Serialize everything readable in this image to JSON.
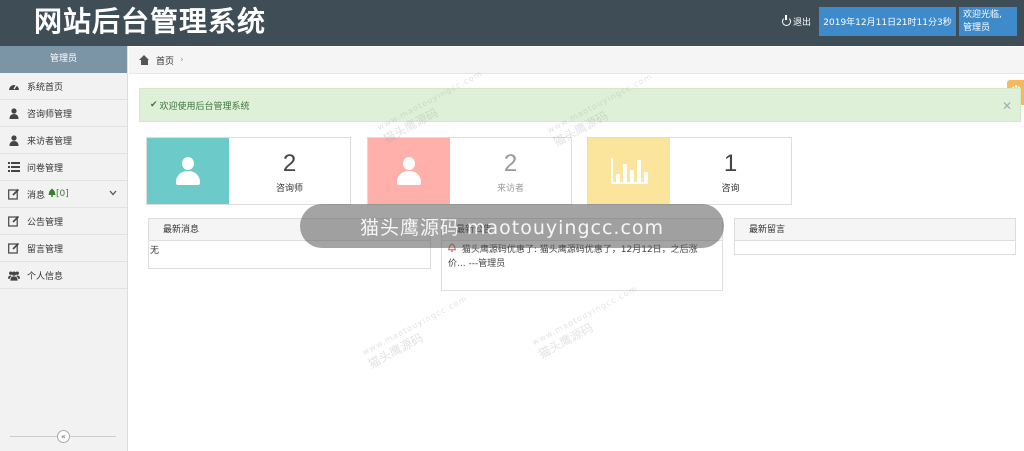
{
  "header": {
    "title": "网站后台管理系统",
    "logout_label": "退出",
    "datetime": "2019年12月11日21时11分3秒",
    "welcome_line1": "欢迎光临,",
    "welcome_line2": "管理员"
  },
  "sidebar": {
    "heading": "管理员",
    "items": [
      {
        "label": "系统首页",
        "icon": "dashboard-icon"
      },
      {
        "label": "咨询师管理",
        "icon": "user-icon"
      },
      {
        "label": "来访者管理",
        "icon": "user-icon"
      },
      {
        "label": "问卷管理",
        "icon": "list-icon"
      },
      {
        "label": "消息",
        "badge": "[0]",
        "icon": "edit-icon"
      },
      {
        "label": "公告管理",
        "icon": "edit-icon"
      },
      {
        "label": "留言管理",
        "icon": "edit-icon"
      },
      {
        "label": "个人信息",
        "icon": "users-icon"
      }
    ]
  },
  "breadcrumb": {
    "home_label": "首页"
  },
  "alert": {
    "message": "欢迎使用后台管理系统"
  },
  "stats": [
    {
      "value": "2",
      "label": "咨询师",
      "color": "#6ccac9"
    },
    {
      "value": "2",
      "label": "来访者",
      "color": "#ff9e9e"
    },
    {
      "value": "1",
      "label": "咨询",
      "color": "#fce38a"
    }
  ],
  "panels": {
    "messages": {
      "title": "最新消息",
      "empty_text": "无"
    },
    "notices": {
      "title": "最新公告",
      "item_line1": "猫头鹰源码优惠了: 猫头鹰源码优惠了，12月12日，之后涨",
      "item_line2": "价... ---管理员"
    },
    "comments": {
      "title": "最新留言"
    }
  },
  "watermarks": {
    "main": "猫头鹰源码 maotouyingcc.com",
    "ghost": "猫头鹰源码",
    "ghost_url": "www.maotouyingcc.com"
  },
  "colors": {
    "header_bg": "#3f4d57",
    "sidebar_head": "#7b94a6",
    "accent_blue": "#3e8acb",
    "alert_bg": "#dff0d8",
    "alert_text": "#3c763d"
  }
}
